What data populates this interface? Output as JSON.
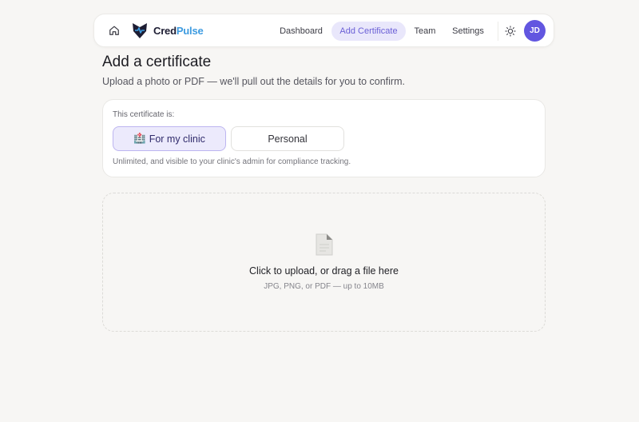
{
  "header": {
    "brand_part1": "Cred",
    "brand_part2": "Pulse",
    "nav": {
      "dashboard": "Dashboard",
      "add_certificate": "Add Certificate",
      "team": "Team",
      "settings": "Settings"
    },
    "active_nav": "Add Certificate",
    "avatar_initials": "JD",
    "icons": [
      "home-icon",
      "heart-pulse-logo",
      "sun-icon"
    ]
  },
  "page": {
    "title": "Add a certificate",
    "subtitle": "Upload a photo or PDF — we'll pull out the details for you to confirm."
  },
  "certificate_type": {
    "label": "This certificate is:",
    "options": [
      "For my clinic",
      "Personal"
    ],
    "selected": "For my clinic",
    "clinic_icon": "🏥",
    "note": "Unlimited, and visible to your clinic's admin for compliance tracking."
  },
  "upload": {
    "title": "Click to upload, or drag a file here",
    "hint": "JPG, PNG, or PDF — up to 10MB",
    "icon": "document-icon"
  },
  "colors": {
    "accent": "#6256e0",
    "active_nav_bg": "#e9e7fb",
    "brand_blue": "#3d9be0",
    "selected_option_bg": "#eceafc"
  }
}
